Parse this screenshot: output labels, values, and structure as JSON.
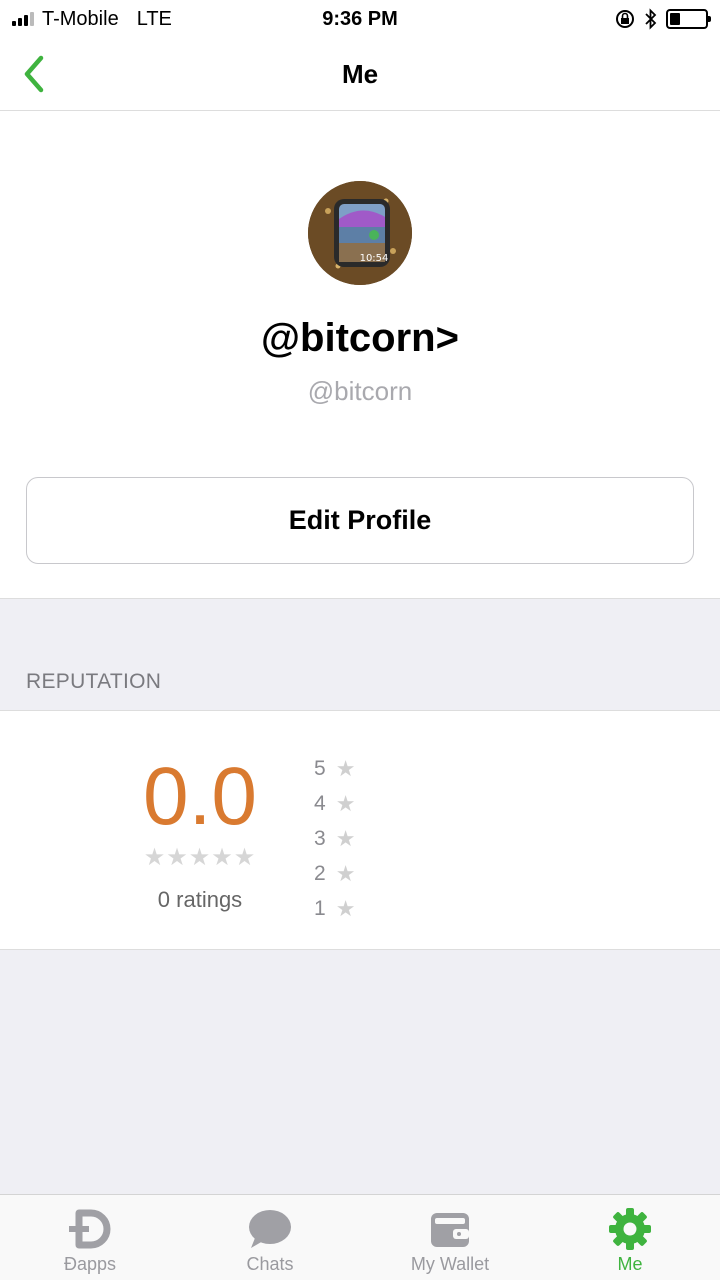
{
  "status_bar": {
    "carrier": "T-Mobile",
    "network": "LTE",
    "time": "9:36 PM",
    "battery_level": 0.3
  },
  "nav": {
    "title": "Me",
    "back_icon": "chevron-left-icon",
    "accent_color": "#3fb33f"
  },
  "profile": {
    "display_name": "@bitcorn>",
    "username": "@bitcorn",
    "edit_button_label": "Edit Profile"
  },
  "reputation": {
    "section_title": "REPUTATION",
    "score": "0.0",
    "stars": "★★★★★",
    "ratings_label": "0 ratings",
    "score_color": "#d97a30",
    "breakdown": [
      {
        "stars": "5",
        "icon": "★"
      },
      {
        "stars": "4",
        "icon": "★"
      },
      {
        "stars": "3",
        "icon": "★"
      },
      {
        "stars": "2",
        "icon": "★"
      },
      {
        "stars": "1",
        "icon": "★"
      }
    ]
  },
  "tab_bar": {
    "tabs": [
      {
        "label": "Ðapps",
        "icon": "dapps-icon",
        "active": false
      },
      {
        "label": "Chats",
        "icon": "chat-bubble-icon",
        "active": false
      },
      {
        "label": "My Wallet",
        "icon": "wallet-icon",
        "active": false
      },
      {
        "label": "Me",
        "icon": "gear-icon",
        "active": true
      }
    ]
  }
}
